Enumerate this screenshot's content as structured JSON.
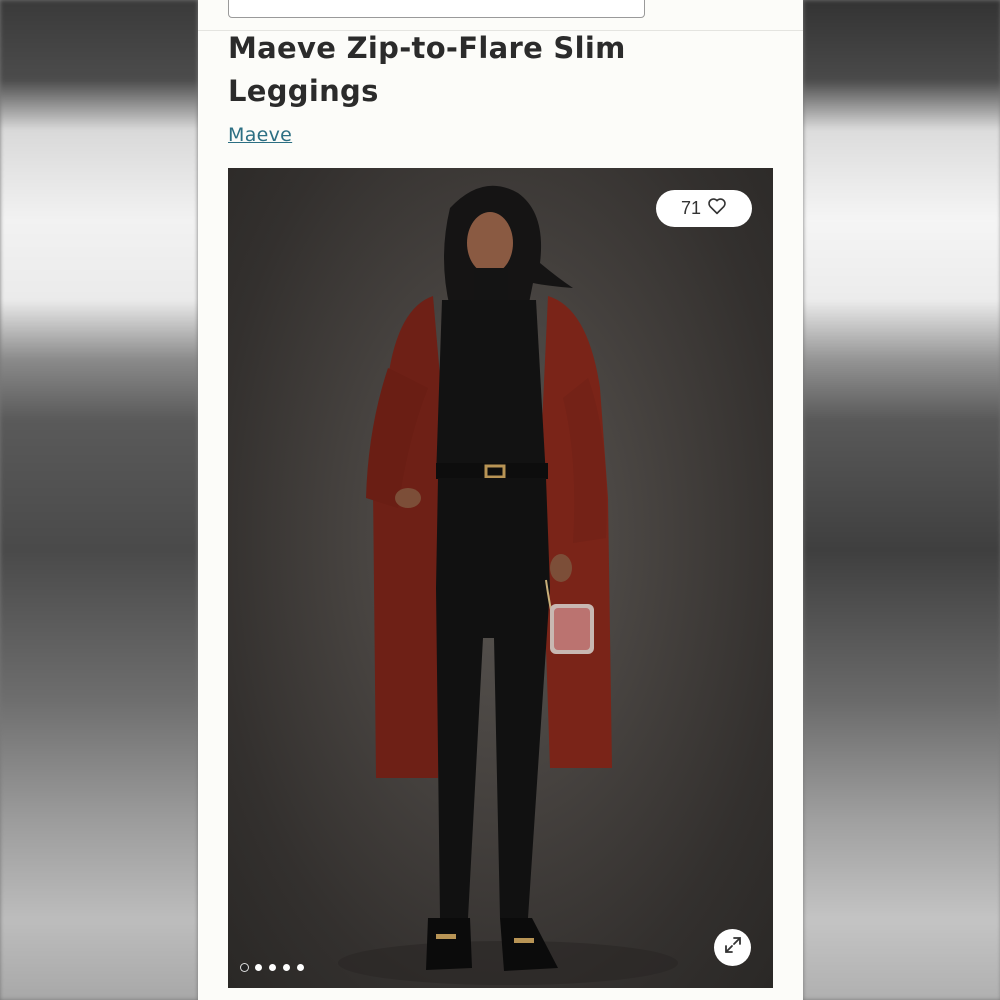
{
  "product": {
    "title": "Maeve Zip-to-Flare Slim Leggings",
    "brand": "Maeve"
  },
  "gallery": {
    "favorite_count": "71",
    "slide_count": 5,
    "active_slide": 1,
    "favorite_icon": "heart-icon",
    "expand_icon": "expand-icon"
  },
  "colors": {
    "brand_link": "#2c6f83",
    "coat": "#7a2418",
    "background": "#fcfcf9"
  }
}
